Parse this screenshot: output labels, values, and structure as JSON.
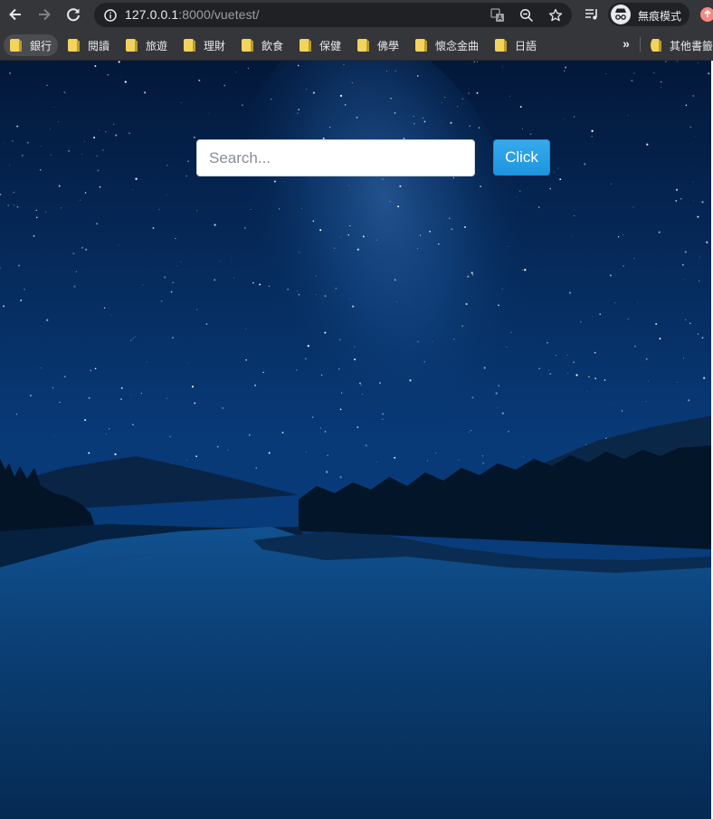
{
  "browser": {
    "url_host": "127.0.0.1",
    "url_rest": ":8000/vuetest/",
    "profile_label": "無痕模式",
    "bookmarks": [
      {
        "label": "銀行"
      },
      {
        "label": "閱讀"
      },
      {
        "label": "旅遊"
      },
      {
        "label": "理財"
      },
      {
        "label": "飲食"
      },
      {
        "label": "保健"
      },
      {
        "label": "佛學"
      },
      {
        "label": "懷念金曲"
      },
      {
        "label": "日語"
      }
    ],
    "other_bookmarks": "其他書籤"
  },
  "page": {
    "search_placeholder": "Search...",
    "search_value": "",
    "button_label": "Click"
  },
  "colors": {
    "button": "#2ea3e8",
    "sky_top": "#041c3f",
    "sky_glow": "#1c5aa0",
    "water": "#0b3a6c"
  },
  "icons": {
    "back": "arrow-left-icon",
    "forward": "arrow-right-icon",
    "reload": "reload-icon",
    "site_info": "info-icon",
    "translate": "translate-icon",
    "zoom": "zoom-out-icon",
    "bookmark_star": "star-icon",
    "media": "media-control-icon",
    "incognito": "incognito-icon",
    "update": "update-icon",
    "more_bookmarks": "chevron-double-right-icon",
    "bookmark_folder": "folder-icon"
  }
}
